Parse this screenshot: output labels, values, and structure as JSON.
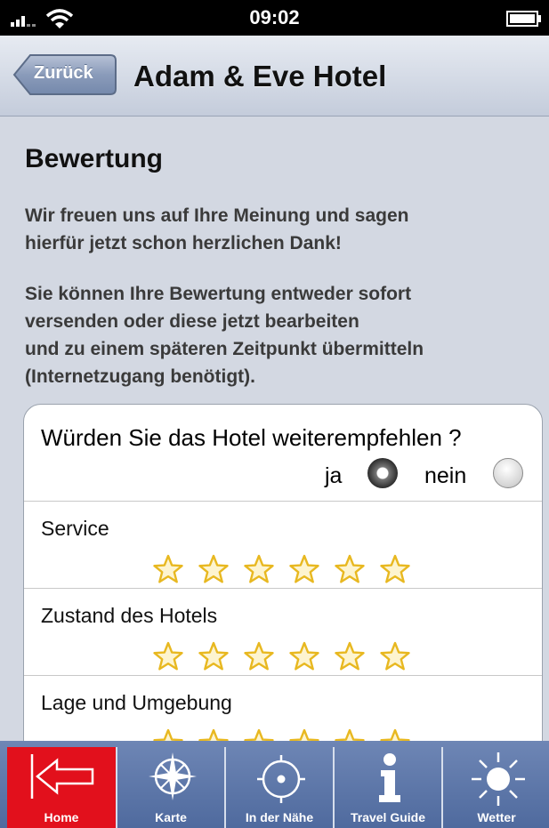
{
  "status_bar": {
    "time": "09:02"
  },
  "nav": {
    "back_label": "Zurück",
    "title": "Adam & Eve Hotel"
  },
  "content": {
    "heading": "Bewertung",
    "paragraph1": "Wir freuen uns auf Ihre Meinung und sagen\nhierfür jetzt schon herzlichen Dank!",
    "paragraph2": "Sie können Ihre Bewertung entweder sofort\nversenden oder diese jetzt bearbeiten\nund zu einem späteren Zeitpunkt übermitteln\n(Internetzugang benötigt)."
  },
  "recommend": {
    "question": "Würden Sie das Hotel weiterempfehlen ?",
    "yes_label": "ja",
    "no_label": "nein",
    "selected": "ja"
  },
  "ratings": [
    {
      "label": "Service",
      "stars_total": 6,
      "stars_filled": 0
    },
    {
      "label": "Zustand des Hotels",
      "stars_total": 6,
      "stars_filled": 0
    },
    {
      "label": "Lage und Umgebung",
      "stars_total": 6,
      "stars_filled": 0
    }
  ],
  "tabs": [
    {
      "label": "Home",
      "icon": "home-arrow-icon",
      "active": true
    },
    {
      "label": "Karte",
      "icon": "compass-icon",
      "active": false
    },
    {
      "label": "In der Nähe",
      "icon": "target-icon",
      "active": false
    },
    {
      "label": "Travel Guide",
      "icon": "info-icon",
      "active": false
    },
    {
      "label": "Wetter",
      "icon": "sun-icon",
      "active": false
    }
  ],
  "colors": {
    "active_tab": "#e2101c",
    "tab_bar": "#5d77a8",
    "star_outline": "#e8b820"
  }
}
